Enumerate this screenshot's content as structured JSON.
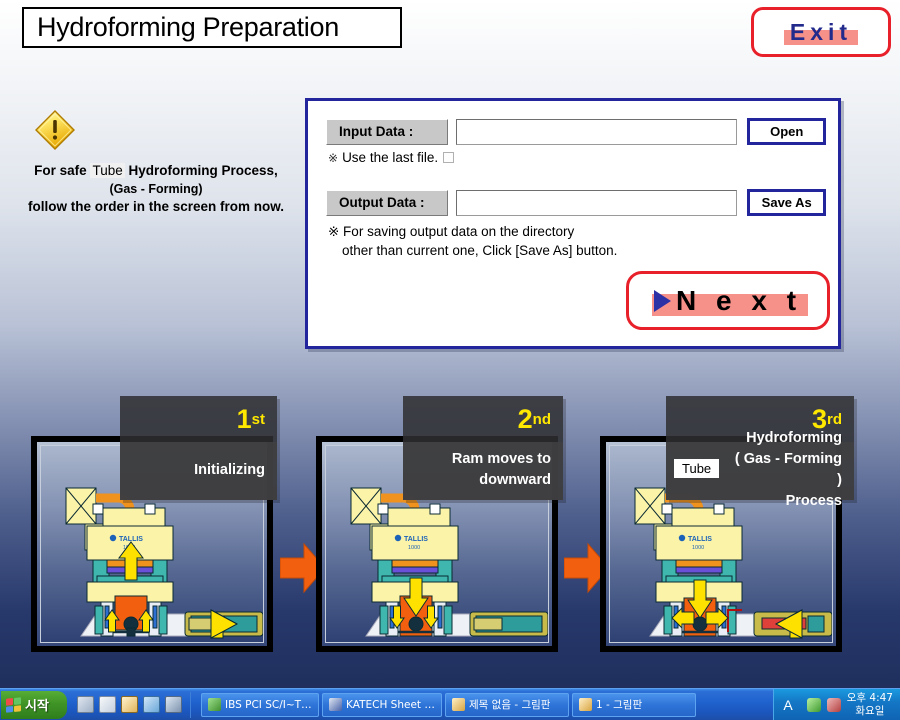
{
  "window": {
    "title": "Hydroforming Preparation"
  },
  "exit": {
    "label": "Exit",
    "border_color": "#e8202a",
    "text_color": "#222a8c",
    "highlight_color": "#f6918a"
  },
  "warning": {
    "icon": "warning-triangle-icon",
    "line1_a": "For safe",
    "line1_tube": "Tube",
    "line1_b": "Hydroforming Process,",
    "line2": "(Gas - Forming)",
    "line3": "follow the order in the screen from now."
  },
  "dialog": {
    "input": {
      "label": "Input Data  :",
      "value": "",
      "placeholder": "",
      "button": "Open"
    },
    "checkbox": {
      "mark": "※",
      "label": "Use the last file.",
      "checked": false
    },
    "output": {
      "label": "Output Data :",
      "value": "",
      "placeholder": "",
      "button": "Save As"
    },
    "note_line1": "※ For saving output data on the directory",
    "note_line2": "other than current one, Click [Save As] button.",
    "next": {
      "label": "N e x t",
      "icon": "play-triangle-icon",
      "border_color": "#e8202a",
      "highlight_color": "#f6918a"
    }
  },
  "steps": [
    {
      "ordinal_num": "1",
      "ordinal_suffix": "st",
      "desc": "Initializing",
      "machine_label": "TALLIS",
      "machine_model": "1000"
    },
    {
      "ordinal_num": "2",
      "ordinal_suffix": "nd",
      "desc_line1": "Ram moves to",
      "desc_line2": "downward",
      "machine_label": "TALLIS",
      "machine_model": "1000"
    },
    {
      "ordinal_num": "3",
      "ordinal_suffix": "rd",
      "chip": "Tube",
      "desc_line1": "Hydroforming",
      "desc_line2": "( Gas - Forming )",
      "desc_line3": "Process",
      "machine_label": "TALLIS",
      "machine_model": "1000"
    }
  ],
  "taskbar": {
    "start_label": "시작",
    "quicklaunch": [
      "show-desktop-icon",
      "notepad-icon",
      "paint-icon",
      "media-icon",
      "computer-icon"
    ],
    "tasks": [
      {
        "label": "IBS PCI SC/I~T  ...",
        "icon": "app-icon"
      },
      {
        "label": "KATECH Sheet Hy...",
        "icon": "app-icon"
      },
      {
        "label": "제목 없음 - 그림판",
        "icon": "paint-icon"
      },
      {
        "label": "1 - 그림판",
        "icon": "paint-icon"
      }
    ],
    "ime": "A",
    "clock_time": "오후 4:47",
    "clock_day": "화요일"
  }
}
